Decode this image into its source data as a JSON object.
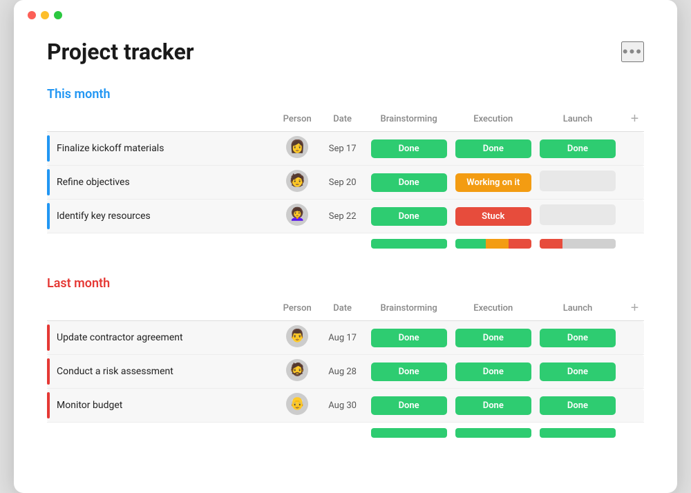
{
  "window": {
    "title": "Project tracker",
    "more_icon": "•••"
  },
  "sections": [
    {
      "id": "this-month",
      "title": "This month",
      "color": "blue",
      "border_color": "blue",
      "columns": [
        "Person",
        "Date",
        "Brainstorming",
        "Execution",
        "Launch"
      ],
      "tasks": [
        {
          "name": "Finalize kickoff materials",
          "avatar": "👩",
          "date": "Sep 17",
          "brainstorming": "Done",
          "execution": "Done",
          "launch": "Done",
          "b_status": "done",
          "e_status": "done",
          "l_status": "done"
        },
        {
          "name": "Refine objectives",
          "avatar": "🧑",
          "date": "Sep 20",
          "brainstorming": "Done",
          "execution": "Working on it",
          "launch": "",
          "b_status": "done",
          "e_status": "working",
          "l_status": "empty"
        },
        {
          "name": "Identify key resources",
          "avatar": "👩‍🦱",
          "date": "Sep 22",
          "brainstorming": "Done",
          "execution": "Stuck",
          "launch": "",
          "b_status": "done",
          "e_status": "stuck",
          "l_status": "empty"
        }
      ],
      "progress": {
        "brainstorming": [
          {
            "color": "green",
            "pct": 100
          }
        ],
        "execution": [
          {
            "color": "green",
            "pct": 40
          },
          {
            "color": "orange",
            "pct": 30
          },
          {
            "color": "red",
            "pct": 30
          }
        ],
        "launch": [
          {
            "color": "red",
            "pct": 30
          },
          {
            "color": "gray",
            "pct": 70
          }
        ]
      }
    },
    {
      "id": "last-month",
      "title": "Last month",
      "color": "red",
      "border_color": "red",
      "columns": [
        "Person",
        "Date",
        "Brainstorming",
        "Execution",
        "Launch"
      ],
      "tasks": [
        {
          "name": "Update contractor agreement",
          "avatar": "👨",
          "date": "Aug 17",
          "brainstorming": "Done",
          "execution": "Done",
          "launch": "Done",
          "b_status": "done",
          "e_status": "done",
          "l_status": "done"
        },
        {
          "name": "Conduct a risk assessment",
          "avatar": "🧔",
          "date": "Aug 28",
          "brainstorming": "Done",
          "execution": "Done",
          "launch": "Done",
          "b_status": "done",
          "e_status": "done",
          "l_status": "done"
        },
        {
          "name": "Monitor budget",
          "avatar": "👴",
          "date": "Aug 30",
          "brainstorming": "Done",
          "execution": "Done",
          "launch": "Done",
          "b_status": "done",
          "e_status": "done",
          "l_status": "done"
        }
      ],
      "progress": {
        "brainstorming": [
          {
            "color": "green",
            "pct": 100
          }
        ],
        "execution": [
          {
            "color": "green",
            "pct": 100
          }
        ],
        "launch": [
          {
            "color": "green",
            "pct": 100
          }
        ]
      }
    }
  ]
}
